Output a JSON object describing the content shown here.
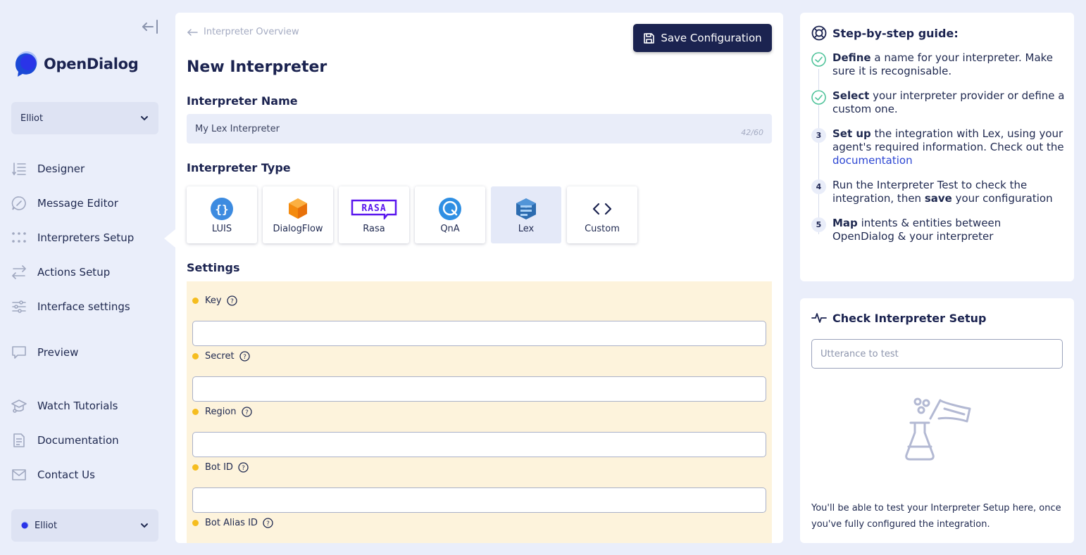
{
  "app": {
    "name": "OpenDialog"
  },
  "sidebar": {
    "workspace_top": "Elliot",
    "workspace_bottom": "Elliot",
    "items": [
      {
        "label": "Designer",
        "icon": "designer-icon"
      },
      {
        "label": "Message Editor",
        "icon": "message-editor-icon"
      },
      {
        "label": "Interpreters Setup",
        "icon": "interpreters-icon",
        "active": true
      },
      {
        "label": "Actions Setup",
        "icon": "actions-icon"
      },
      {
        "label": "Interface settings",
        "icon": "sliders-icon"
      },
      {
        "label": "Preview",
        "icon": "preview-icon"
      },
      {
        "label": "Watch Tutorials",
        "icon": "tutorials-icon"
      },
      {
        "label": "Documentation",
        "icon": "document-icon"
      },
      {
        "label": "Contact Us",
        "icon": "mail-icon"
      }
    ]
  },
  "main": {
    "breadcrumb": "Interpreter Overview",
    "save_label": "Save Configuration",
    "title": "New Interpreter",
    "name_section": "Interpreter Name",
    "name_value": "My Lex Interpreter",
    "name_counter": "42/60",
    "type_section": "Interpreter Type",
    "providers": [
      {
        "label": "LUIS",
        "icon": "luis-icon"
      },
      {
        "label": "DialogFlow",
        "icon": "dialogflow-icon"
      },
      {
        "label": "Rasa",
        "icon": "rasa-icon"
      },
      {
        "label": "QnA",
        "icon": "qna-icon"
      },
      {
        "label": "Lex",
        "icon": "lex-icon",
        "selected": true
      },
      {
        "label": "Custom",
        "icon": "code-icon"
      }
    ],
    "settings_section": "Settings",
    "settings": [
      {
        "label": "Key"
      },
      {
        "label": "Secret"
      },
      {
        "label": "Region"
      },
      {
        "label": "Bot ID"
      },
      {
        "label": "Bot Alias ID"
      }
    ]
  },
  "guide": {
    "title": "Step-by-step guide:",
    "steps": [
      {
        "badge": "",
        "done": true,
        "bold": "Define",
        "text": " a name for your interpreter. Make sure it is recognisable."
      },
      {
        "badge": "",
        "done": true,
        "bold": "Select",
        "text": " your interpreter provider or define a custom one."
      },
      {
        "badge": "3",
        "bold": "Set up",
        "text": " the integration with Lex, using your agent's required information. Check out the ",
        "link": "documentation"
      },
      {
        "badge": "4",
        "pre": "Run the Interpreter Test to check the integration, then ",
        "bold": "save",
        "text": " your configuration"
      },
      {
        "badge": "5",
        "bold": "Map",
        "text": " intents & entities between OpenDialog & your interpreter"
      }
    ]
  },
  "checker": {
    "title": "Check Interpreter Setup",
    "placeholder": "Utterance to test",
    "hint": "You'll be able to test your Interpreter Setup here, once you've fully configured the integration."
  }
}
